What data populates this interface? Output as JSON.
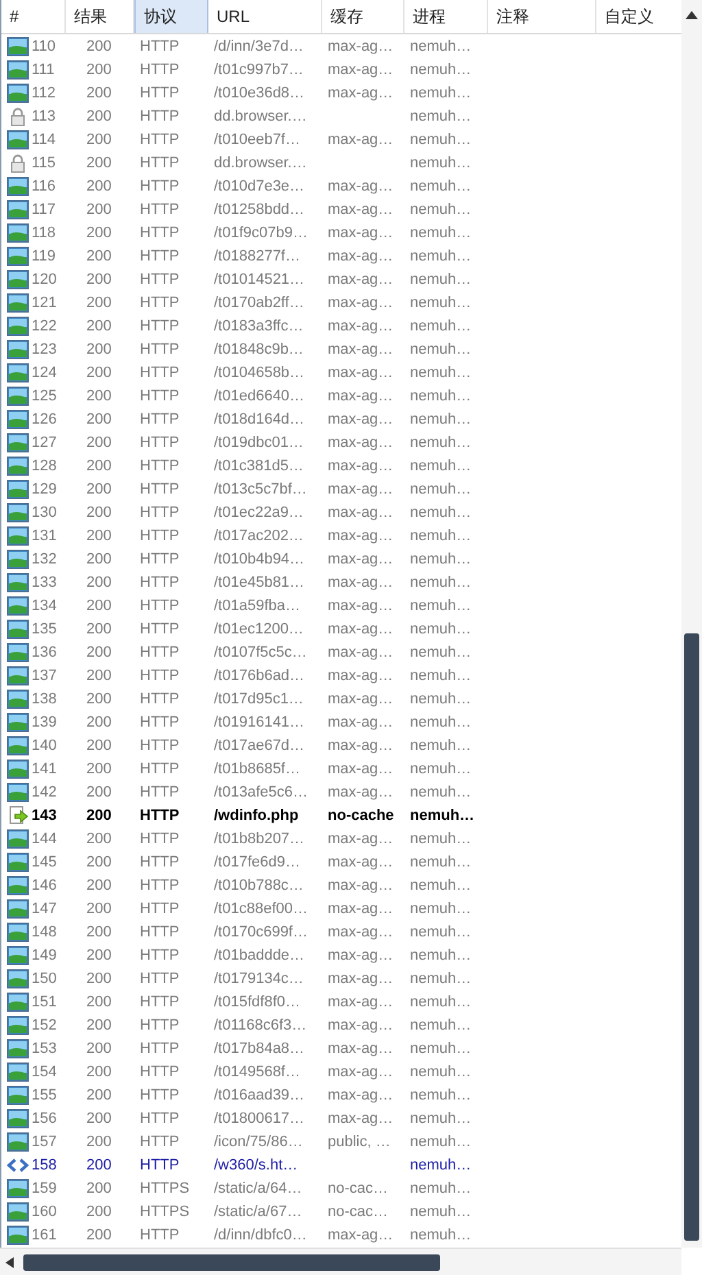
{
  "columns": [
    {
      "label": "#",
      "selected": false
    },
    {
      "label": "结果",
      "selected": false
    },
    {
      "label": "协议",
      "selected": true
    },
    {
      "label": "URL",
      "selected": false
    },
    {
      "label": "缓存",
      "selected": false
    },
    {
      "label": "进程",
      "selected": false
    },
    {
      "label": "注释",
      "selected": false
    },
    {
      "label": "自定义",
      "selected": false
    }
  ],
  "rows": [
    {
      "kind": "image",
      "num": "110",
      "result": "200",
      "protocol": "HTTP",
      "url": "/d/inn/3e7d…",
      "cache": "max-ag…",
      "process": "nemuh…"
    },
    {
      "kind": "image",
      "num": "111",
      "result": "200",
      "protocol": "HTTP",
      "url": "/t01c997b7…",
      "cache": "max-ag…",
      "process": "nemuh…"
    },
    {
      "kind": "image",
      "num": "112",
      "result": "200",
      "protocol": "HTTP",
      "url": "/t010e36d8…",
      "cache": "max-ag…",
      "process": "nemuh…"
    },
    {
      "kind": "lock",
      "num": "113",
      "result": "200",
      "protocol": "HTTP",
      "url": "dd.browser.…",
      "process": "nemuh…"
    },
    {
      "kind": "image",
      "num": "114",
      "result": "200",
      "protocol": "HTTP",
      "url": "/t010eeb7f…",
      "cache": "max-ag…",
      "process": "nemuh…"
    },
    {
      "kind": "lock",
      "num": "115",
      "result": "200",
      "protocol": "HTTP",
      "url": "dd.browser.…",
      "process": "nemuh…"
    },
    {
      "kind": "image",
      "num": "116",
      "result": "200",
      "protocol": "HTTP",
      "url": "/t010d7e3e…",
      "cache": "max-ag…",
      "process": "nemuh…"
    },
    {
      "kind": "image",
      "num": "117",
      "result": "200",
      "protocol": "HTTP",
      "url": "/t01258bdd…",
      "cache": "max-ag…",
      "process": "nemuh…"
    },
    {
      "kind": "image",
      "num": "118",
      "result": "200",
      "protocol": "HTTP",
      "url": "/t01f9c07b9…",
      "cache": "max-ag…",
      "process": "nemuh…"
    },
    {
      "kind": "image",
      "num": "119",
      "result": "200",
      "protocol": "HTTP",
      "url": "/t0188277f…",
      "cache": "max-ag…",
      "process": "nemuh…"
    },
    {
      "kind": "image",
      "num": "120",
      "result": "200",
      "protocol": "HTTP",
      "url": "/t01014521…",
      "cache": "max-ag…",
      "process": "nemuh…"
    },
    {
      "kind": "image",
      "num": "121",
      "result": "200",
      "protocol": "HTTP",
      "url": "/t0170ab2ff…",
      "cache": "max-ag…",
      "process": "nemuh…"
    },
    {
      "kind": "image",
      "num": "122",
      "result": "200",
      "protocol": "HTTP",
      "url": "/t0183a3ffc…",
      "cache": "max-ag…",
      "process": "nemuh…"
    },
    {
      "kind": "image",
      "num": "123",
      "result": "200",
      "protocol": "HTTP",
      "url": "/t01848c9b…",
      "cache": "max-ag…",
      "process": "nemuh…"
    },
    {
      "kind": "image",
      "num": "124",
      "result": "200",
      "protocol": "HTTP",
      "url": "/t0104658b…",
      "cache": "max-ag…",
      "process": "nemuh…"
    },
    {
      "kind": "image",
      "num": "125",
      "result": "200",
      "protocol": "HTTP",
      "url": "/t01ed6640…",
      "cache": "max-ag…",
      "process": "nemuh…"
    },
    {
      "kind": "image",
      "num": "126",
      "result": "200",
      "protocol": "HTTP",
      "url": "/t018d164d…",
      "cache": "max-ag…",
      "process": "nemuh…"
    },
    {
      "kind": "image",
      "num": "127",
      "result": "200",
      "protocol": "HTTP",
      "url": "/t019dbc01…",
      "cache": "max-ag…",
      "process": "nemuh…"
    },
    {
      "kind": "image",
      "num": "128",
      "result": "200",
      "protocol": "HTTP",
      "url": "/t01c381d5…",
      "cache": "max-ag…",
      "process": "nemuh…"
    },
    {
      "kind": "image",
      "num": "129",
      "result": "200",
      "protocol": "HTTP",
      "url": "/t013c5c7bf…",
      "cache": "max-ag…",
      "process": "nemuh…"
    },
    {
      "kind": "image",
      "num": "130",
      "result": "200",
      "protocol": "HTTP",
      "url": "/t01ec22a9…",
      "cache": "max-ag…",
      "process": "nemuh…"
    },
    {
      "kind": "image",
      "num": "131",
      "result": "200",
      "protocol": "HTTP",
      "url": "/t017ac202…",
      "cache": "max-ag…",
      "process": "nemuh…"
    },
    {
      "kind": "image",
      "num": "132",
      "result": "200",
      "protocol": "HTTP",
      "url": "/t010b4b94…",
      "cache": "max-ag…",
      "process": "nemuh…"
    },
    {
      "kind": "image",
      "num": "133",
      "result": "200",
      "protocol": "HTTP",
      "url": "/t01e45b81…",
      "cache": "max-ag…",
      "process": "nemuh…"
    },
    {
      "kind": "image",
      "num": "134",
      "result": "200",
      "protocol": "HTTP",
      "url": "/t01a59fba…",
      "cache": "max-ag…",
      "process": "nemuh…"
    },
    {
      "kind": "image",
      "num": "135",
      "result": "200",
      "protocol": "HTTP",
      "url": "/t01ec1200…",
      "cache": "max-ag…",
      "process": "nemuh…"
    },
    {
      "kind": "image",
      "num": "136",
      "result": "200",
      "protocol": "HTTP",
      "url": "/t0107f5c5c…",
      "cache": "max-ag…",
      "process": "nemuh…"
    },
    {
      "kind": "image",
      "num": "137",
      "result": "200",
      "protocol": "HTTP",
      "url": "/t0176b6ad…",
      "cache": "max-ag…",
      "process": "nemuh…"
    },
    {
      "kind": "image",
      "num": "138",
      "result": "200",
      "protocol": "HTTP",
      "url": "/t017d95c1…",
      "cache": "max-ag…",
      "process": "nemuh…"
    },
    {
      "kind": "image",
      "num": "139",
      "result": "200",
      "protocol": "HTTP",
      "url": "/t01916141…",
      "cache": "max-ag…",
      "process": "nemuh…"
    },
    {
      "kind": "image",
      "num": "140",
      "result": "200",
      "protocol": "HTTP",
      "url": "/t017ae67d…",
      "cache": "max-ag…",
      "process": "nemuh…"
    },
    {
      "kind": "image",
      "num": "141",
      "result": "200",
      "protocol": "HTTP",
      "url": "/t01b8685f…",
      "cache": "max-ag…",
      "process": "nemuh…"
    },
    {
      "kind": "image",
      "num": "142",
      "result": "200",
      "protocol": "HTTP",
      "url": "/t013afe5c6…",
      "cache": "max-ag…",
      "process": "nemuh…"
    },
    {
      "kind": "script",
      "num": "143",
      "result": "200",
      "protocol": "HTTP",
      "url": "/wdinfo.php",
      "cache": "no-cache",
      "process": "nemuh…"
    },
    {
      "kind": "image",
      "num": "144",
      "result": "200",
      "protocol": "HTTP",
      "url": "/t01b8b207…",
      "cache": "max-ag…",
      "process": "nemuh…"
    },
    {
      "kind": "image",
      "num": "145",
      "result": "200",
      "protocol": "HTTP",
      "url": "/t017fe6d9…",
      "cache": "max-ag…",
      "process": "nemuh…"
    },
    {
      "kind": "image",
      "num": "146",
      "result": "200",
      "protocol": "HTTP",
      "url": "/t010b788c…",
      "cache": "max-ag…",
      "process": "nemuh…"
    },
    {
      "kind": "image",
      "num": "147",
      "result": "200",
      "protocol": "HTTP",
      "url": "/t01c88ef00…",
      "cache": "max-ag…",
      "process": "nemuh…"
    },
    {
      "kind": "image",
      "num": "148",
      "result": "200",
      "protocol": "HTTP",
      "url": "/t0170c699f…",
      "cache": "max-ag…",
      "process": "nemuh…"
    },
    {
      "kind": "image",
      "num": "149",
      "result": "200",
      "protocol": "HTTP",
      "url": "/t01baddde…",
      "cache": "max-ag…",
      "process": "nemuh…"
    },
    {
      "kind": "image",
      "num": "150",
      "result": "200",
      "protocol": "HTTP",
      "url": "/t0179134c…",
      "cache": "max-ag…",
      "process": "nemuh…"
    },
    {
      "kind": "image",
      "num": "151",
      "result": "200",
      "protocol": "HTTP",
      "url": "/t015fdf8f0…",
      "cache": "max-ag…",
      "process": "nemuh…"
    },
    {
      "kind": "image",
      "num": "152",
      "result": "200",
      "protocol": "HTTP",
      "url": "/t01168c6f3…",
      "cache": "max-ag…",
      "process": "nemuh…"
    },
    {
      "kind": "image",
      "num": "153",
      "result": "200",
      "protocol": "HTTP",
      "url": "/t017b84a8…",
      "cache": "max-ag…",
      "process": "nemuh…"
    },
    {
      "kind": "image",
      "num": "154",
      "result": "200",
      "protocol": "HTTP",
      "url": "/t0149568f…",
      "cache": "max-ag…",
      "process": "nemuh…"
    },
    {
      "kind": "image",
      "num": "155",
      "result": "200",
      "protocol": "HTTP",
      "url": "/t016aad39…",
      "cache": "max-ag…",
      "process": "nemuh…"
    },
    {
      "kind": "image",
      "num": "156",
      "result": "200",
      "protocol": "HTTP",
      "url": "/t01800617…",
      "cache": "max-ag…",
      "process": "nemuh…"
    },
    {
      "kind": "image",
      "num": "157",
      "result": "200",
      "protocol": "HTTP",
      "url": "/icon/75/86…",
      "cache": "public, …",
      "process": "nemuh…"
    },
    {
      "kind": "html",
      "num": "158",
      "result": "200",
      "protocol": "HTTP",
      "url": "/w360/s.ht…",
      "process": "nemuh…"
    },
    {
      "kind": "image",
      "num": "159",
      "result": "200",
      "protocol": "HTTPS",
      "url": "/static/a/64…",
      "cache": "no-cac…",
      "process": "nemuh…"
    },
    {
      "kind": "image",
      "num": "160",
      "result": "200",
      "protocol": "HTTPS",
      "url": "/static/a/67…",
      "cache": "no-cac…",
      "process": "nemuh…"
    },
    {
      "kind": "image",
      "num": "161",
      "result": "200",
      "protocol": "HTTP",
      "url": "/d/inn/dbfc0…",
      "cache": "max-ag…",
      "process": "nemuh…"
    }
  ]
}
